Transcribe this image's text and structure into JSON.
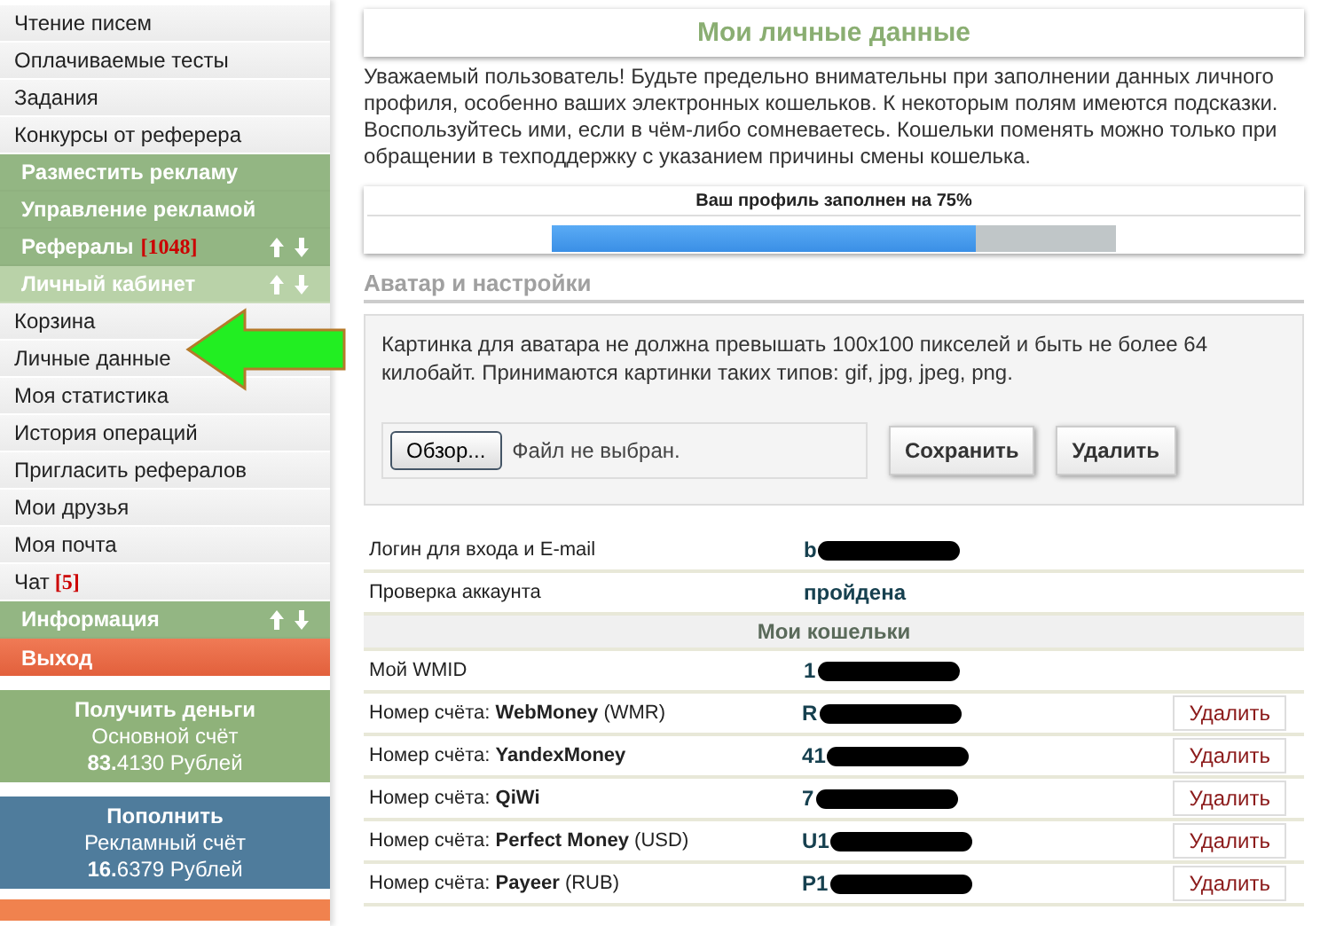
{
  "sidebar": {
    "items": [
      {
        "kind": "link",
        "label": "Чтение писем"
      },
      {
        "kind": "link",
        "label": "Оплачиваемые тесты"
      },
      {
        "kind": "link",
        "label": "Задания"
      },
      {
        "kind": "link",
        "label": "Конкурсы от реферера"
      },
      {
        "kind": "section",
        "label": "Разместить рекламу",
        "expanded": false,
        "collapsible": false
      },
      {
        "kind": "section",
        "label": "Управление рекламой",
        "expanded": false,
        "collapsible": false
      },
      {
        "kind": "section",
        "label": "Рефералы",
        "badge": "[1048]",
        "expanded": false,
        "collapsible": true
      },
      {
        "kind": "section",
        "label": "Личный кабинет",
        "expanded": true,
        "collapsible": true
      },
      {
        "kind": "link",
        "label": "Корзина"
      },
      {
        "kind": "link",
        "label": "Личные данные",
        "pointed": true
      },
      {
        "kind": "link",
        "label": "Моя статистика"
      },
      {
        "kind": "link",
        "label": "История операций"
      },
      {
        "kind": "link",
        "label": "Пригласить рефералов"
      },
      {
        "kind": "link",
        "label": "Мои друзья"
      },
      {
        "kind": "link",
        "label": "Моя почта"
      },
      {
        "kind": "link",
        "label": "Чат",
        "badge": "[5]"
      },
      {
        "kind": "section",
        "label": "Информация",
        "expanded": false,
        "collapsible": true
      },
      {
        "kind": "exit",
        "label": "Выход"
      }
    ],
    "cards": [
      {
        "kind": "withdraw",
        "action": "Получить деньги",
        "account": "Основной счёт",
        "balance": "**83.**4130 Рублей"
      },
      {
        "kind": "deposit",
        "action": "Пополнить",
        "account": "Рекламный счёт",
        "balance": "**16.**6379 Рублей"
      }
    ]
  },
  "page": {
    "title": "Мои личные данные",
    "intro": "Уважаемый пользователь! Будьте предельно внимательны при заполнении данных личного профиля, особенно ваших электронных кошельков. К некоторым полям имеются подсказки. Воспользуйтесь ими, если в чём-либо сомневаетесь. Кошельки поменять можно только при обращении в техподдержку с указанием причины смены кошелька.",
    "progress": {
      "label": "Ваш профиль заполнен на 75%",
      "level": 0.75
    }
  },
  "avatar": {
    "heading": "Аватар и настройки",
    "note": "Картинка для аватара не должна превышать 100x100 пикселей и быть не более 64 килобайт. Принимаются картинки таких типов: gif, jpg, jpeg, png.",
    "browse_button": "Обзор...",
    "file_status": "Файл не выбран.",
    "buttons": [
      "Сохранить",
      "Удалить"
    ]
  },
  "profile_table": {
    "rows": [
      {
        "kind": "info",
        "label": "Логин для входа и E-mail",
        "value": "b",
        "redacted": true
      },
      {
        "kind": "info",
        "label": "Проверка аккаунта",
        "value": "пройдена",
        "redacted": false
      },
      {
        "kind": "header",
        "label": "Мои кошельки"
      },
      {
        "kind": "info",
        "label": "Мой WMID",
        "value": "1",
        "redacted": true
      },
      {
        "kind": "wallet",
        "label": "Номер счёта: **WebMoney** (WMR)",
        "value": "R",
        "redacted": true,
        "action": "Удалить"
      },
      {
        "kind": "wallet",
        "label": "Номер счёта: **YandexMoney**",
        "value": "41",
        "redacted": true,
        "action": "Удалить"
      },
      {
        "kind": "wallet",
        "label": "Номер счёта: **QiWi**",
        "value": "7",
        "redacted": true,
        "action": "Удалить"
      },
      {
        "kind": "wallet",
        "label": "Номер счёта: **Perfect Money** (USD)",
        "value": "U1",
        "redacted": true,
        "action": "Удалить"
      },
      {
        "kind": "wallet",
        "label": "Номер счёта: **Payeer** (RUB)",
        "value": "P1",
        "redacted": true,
        "action": "Удалить"
      }
    ]
  }
}
